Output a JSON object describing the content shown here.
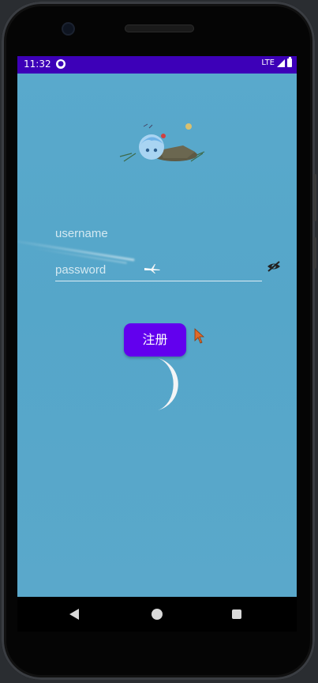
{
  "status_bar": {
    "time": "11:32",
    "network": "LTE"
  },
  "login_form": {
    "username_placeholder": "username",
    "password_placeholder": "password",
    "register_button_label": "注册"
  },
  "colors": {
    "status_bar": "#3d00b8",
    "button": "#6200ee",
    "background_sky": "#56a6c9"
  },
  "icons": {
    "app_status": "app-icon",
    "signal": "signal-icon",
    "battery": "battery-icon",
    "password_toggle": "eye-off-icon",
    "back": "back-icon",
    "home": "home-icon",
    "recents": "recents-icon"
  }
}
